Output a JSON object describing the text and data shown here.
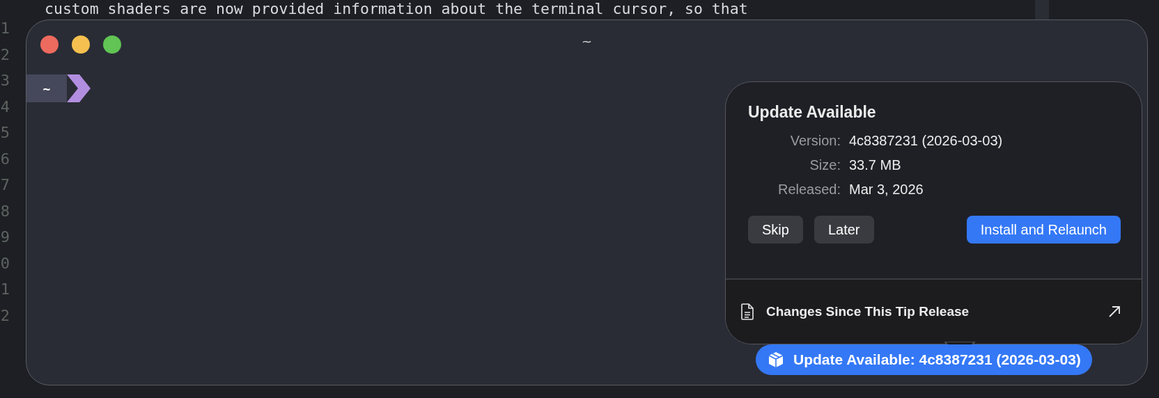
{
  "editor": {
    "top_line": "custom shaders are now provided information about the terminal cursor, so that",
    "gutter": [
      "1",
      "2",
      "3",
      "4",
      "5",
      "6",
      "7",
      "8",
      "9",
      "0",
      "1",
      "2"
    ]
  },
  "window": {
    "title": "~",
    "prompt": {
      "segment": "~"
    }
  },
  "popover": {
    "title": "Update Available",
    "details": [
      {
        "label": "Version:",
        "value": "4c8387231 (2026-03-03)"
      },
      {
        "label": "Size:",
        "value": "33.7 MB"
      },
      {
        "label": "Released:",
        "value": "Mar 3, 2026"
      }
    ],
    "buttons": [
      {
        "label": "Skip",
        "kind": "secondary"
      },
      {
        "label": "Later",
        "kind": "secondary"
      },
      {
        "label": "Install and Relaunch",
        "kind": "primary"
      }
    ],
    "link": {
      "label": "Changes Since This Tip Release"
    }
  },
  "badge": {
    "label": "Update Available: 4c8387231 (2026-03-03)"
  }
}
